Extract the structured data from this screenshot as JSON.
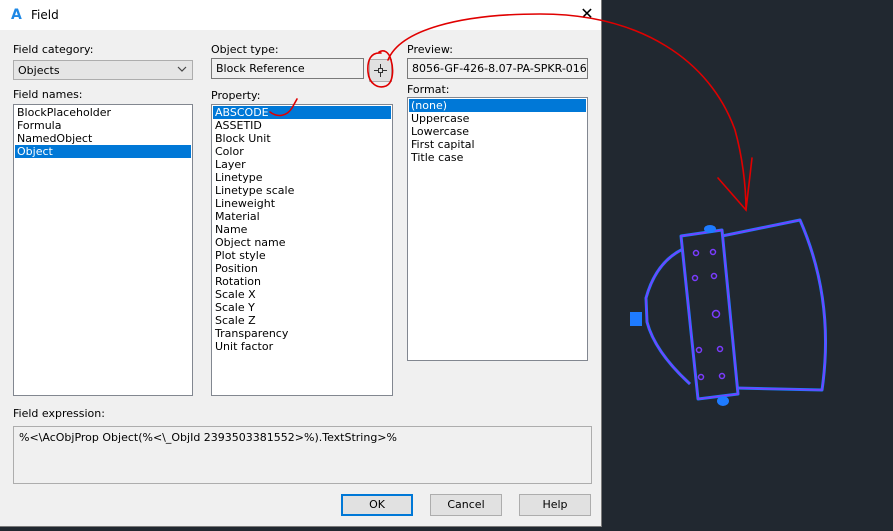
{
  "dialog": {
    "title": "Field",
    "app_icon": "A",
    "close_glyph": "✕"
  },
  "field_category": {
    "label": "Field category:",
    "value": "Objects"
  },
  "field_names": {
    "label": "Field names:",
    "items": [
      "BlockPlaceholder",
      "Formula",
      "NamedObject",
      "Object"
    ],
    "selected": "Object"
  },
  "object_type": {
    "label": "Object type:",
    "value": "Block Reference",
    "pick_icon": "crosshair-icon"
  },
  "property": {
    "label": "Property:",
    "items": [
      "ABSCODE",
      "ASSETID",
      "Block Unit",
      "Color",
      "Layer",
      "Linetype",
      "Linetype scale",
      "Lineweight",
      "Material",
      "Name",
      "Object name",
      "Plot style",
      "Position",
      "Rotation",
      "Scale X",
      "Scale Y",
      "Scale Z",
      "Transparency",
      "Unit factor"
    ],
    "selected": "ABSCODE"
  },
  "preview": {
    "label": "Preview:",
    "value": "8056-GF-426-8.07-PA-SPKR-016"
  },
  "format": {
    "label": "Format:",
    "items": [
      "(none)",
      "Uppercase",
      "Lowercase",
      "First capital",
      "Title case"
    ],
    "selected": "(none)"
  },
  "field_expression": {
    "label": "Field expression:",
    "value": "%<\\AcObjProp Object(%<\\_ObjId 2393503381552>%).TextString>%"
  },
  "buttons": {
    "ok": "OK",
    "cancel": "Cancel",
    "help": "Help"
  },
  "colors": {
    "canvas_bg": "#212830",
    "selection": "#0078d7",
    "annotation": "#e00000",
    "block_outline": "#7b3cff",
    "block_highlight": "#1e7bff"
  }
}
